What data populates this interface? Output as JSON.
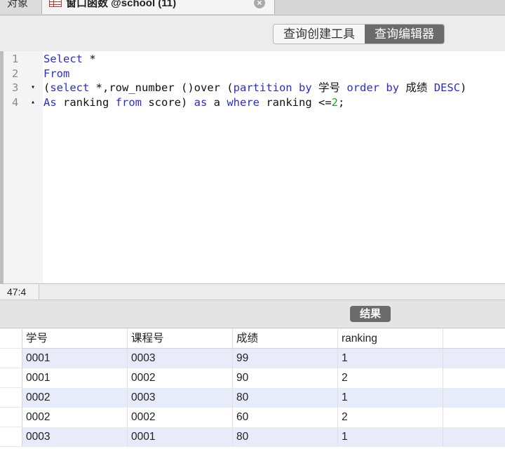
{
  "tabs": {
    "objects_label": "对象",
    "query_tab_label": "窗口函数 @school (11)"
  },
  "toolbar": {
    "builder_label": "查询创建工具",
    "editor_label": "查询编辑器"
  },
  "editor": {
    "lines": [
      {
        "number": "1",
        "fold": "",
        "tokens": [
          [
            "kw",
            "Select"
          ],
          [
            "t",
            " *"
          ]
        ]
      },
      {
        "number": "2",
        "fold": "",
        "tokens": [
          [
            "kw",
            "From"
          ]
        ]
      },
      {
        "number": "3",
        "fold": "▾",
        "tokens": [
          [
            "t",
            "("
          ],
          [
            "kw",
            "select"
          ],
          [
            "t",
            " *,row_number ()over ("
          ],
          [
            "kw",
            "partition"
          ],
          [
            "t",
            " "
          ],
          [
            "kw",
            "by"
          ],
          [
            "t",
            " 学号 "
          ],
          [
            "kw",
            "order"
          ],
          [
            "t",
            " "
          ],
          [
            "kw",
            "by"
          ],
          [
            "t",
            " 成绩 "
          ],
          [
            "kw",
            "DESC"
          ],
          [
            "t",
            ")"
          ]
        ]
      },
      {
        "number": "4",
        "fold": "▴",
        "tokens": [
          [
            "kw",
            "As"
          ],
          [
            "t",
            " ranking "
          ],
          [
            "kw",
            "from"
          ],
          [
            "t",
            " score) "
          ],
          [
            "kw",
            "as"
          ],
          [
            "t",
            " a "
          ],
          [
            "kw",
            "where"
          ],
          [
            "t",
            " ranking <="
          ],
          [
            "num",
            "2"
          ],
          [
            "t",
            ";"
          ]
        ]
      }
    ]
  },
  "status": {
    "cursor_position": "47:4"
  },
  "result": {
    "label": "结果",
    "columns": [
      "学号",
      "课程号",
      "成绩",
      "ranking"
    ],
    "rows": [
      [
        "0001",
        "0003",
        "99",
        "1"
      ],
      [
        "0001",
        "0002",
        "90",
        "2"
      ],
      [
        "0002",
        "0003",
        "80",
        "1"
      ],
      [
        "0002",
        "0002",
        "60",
        "2"
      ],
      [
        "0003",
        "0001",
        "80",
        "1"
      ]
    ]
  }
}
